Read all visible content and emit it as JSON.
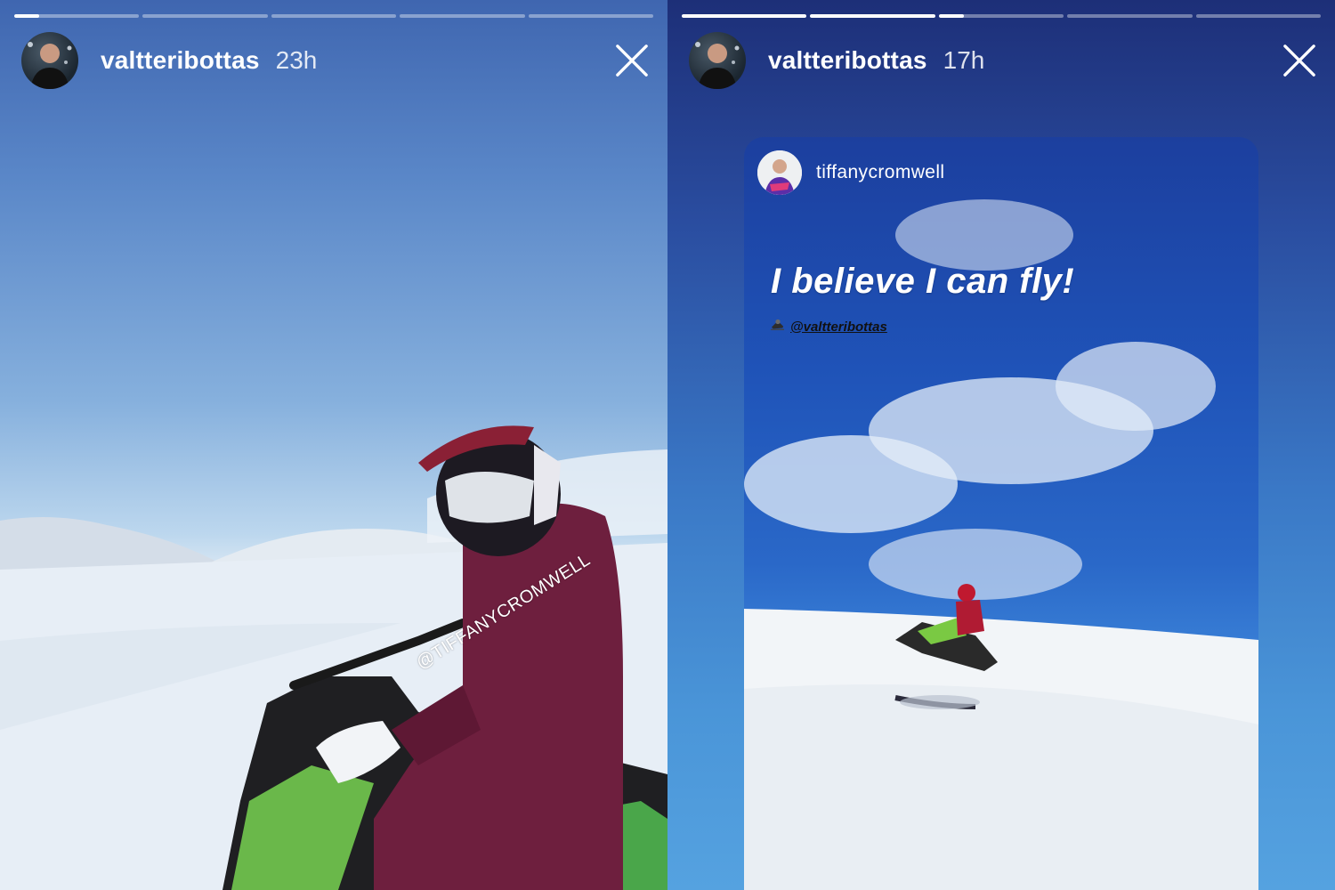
{
  "stories": [
    {
      "username": "valtteribottas",
      "time": "23h",
      "progress": [
        0.2,
        0,
        0,
        0,
        0
      ],
      "sticker_tag": "@TIFFANYCROMWELL",
      "icons": {
        "avatar": "profile-avatar",
        "close": "close-icon"
      }
    },
    {
      "username": "valtteribottas",
      "time": "17h",
      "progress": [
        1,
        1,
        0.2,
        0,
        0
      ],
      "shared_post": {
        "username": "tiffanycromwell",
        "caption": "I believe I can fly!",
        "mention": "@valtteribottas",
        "mention_icon": "snowmobile-emoji"
      },
      "icons": {
        "avatar": "profile-avatar",
        "close": "close-icon"
      }
    }
  ],
  "colors": {
    "progress_track": "rgba(255,255,255,0.38)",
    "progress_fill": "#ffffff",
    "text": "#ffffff"
  }
}
